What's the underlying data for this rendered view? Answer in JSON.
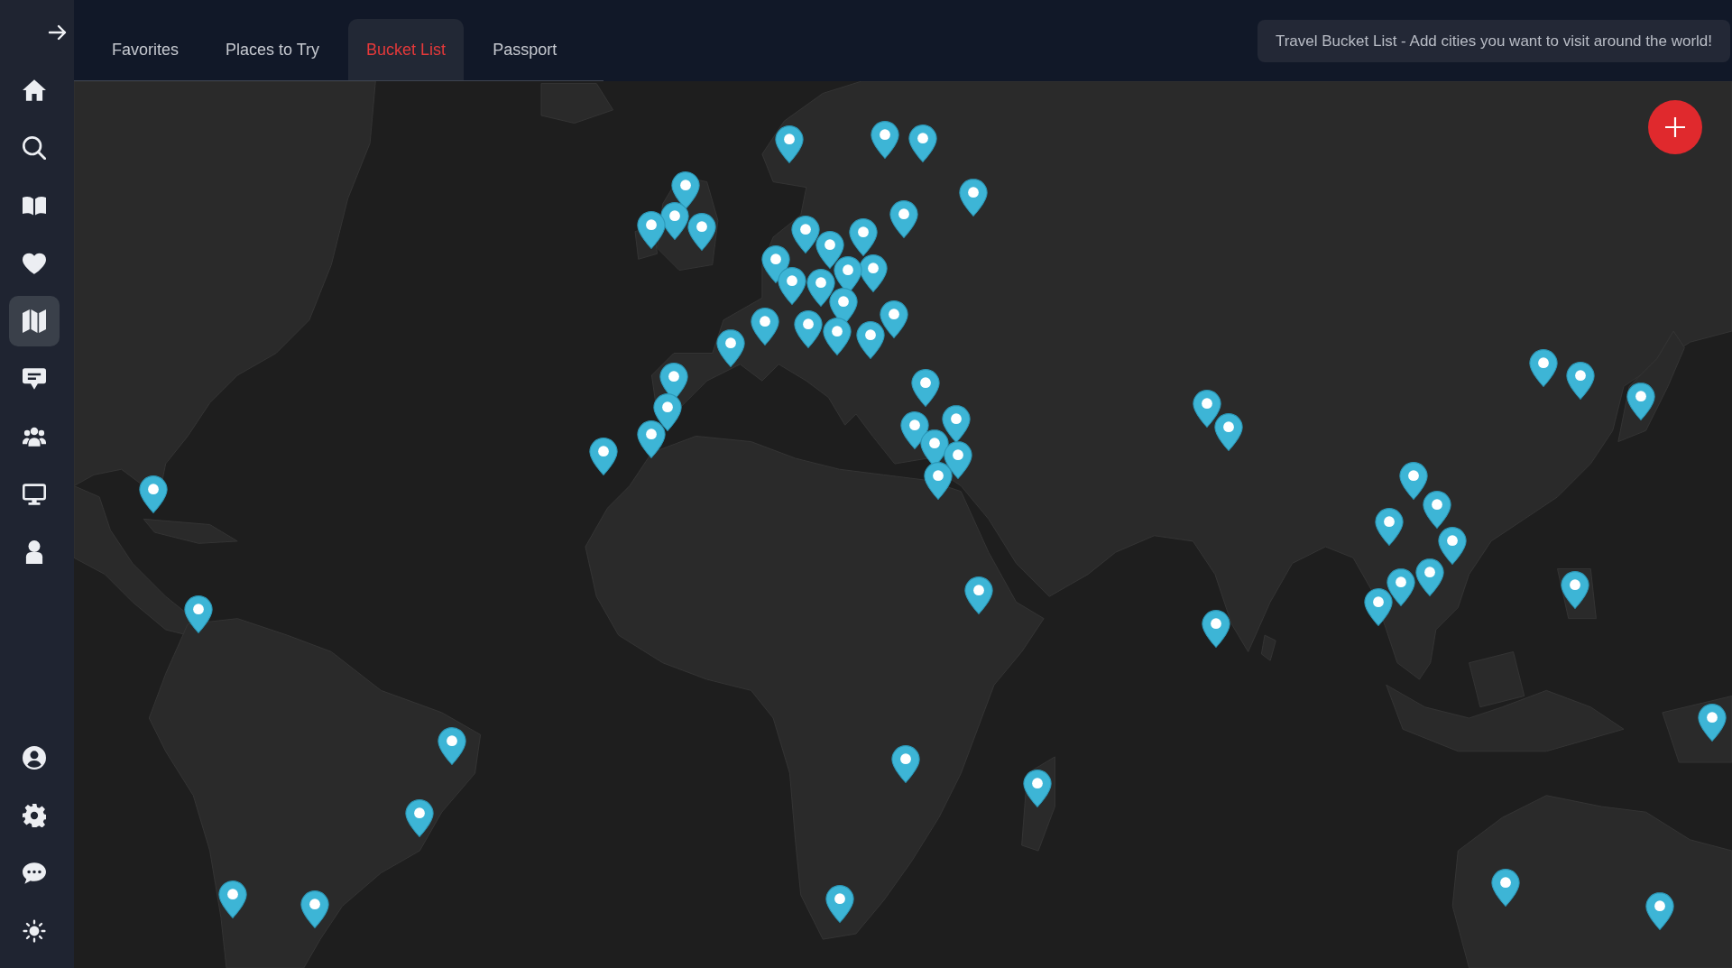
{
  "sidebar": {
    "nav_items": [
      {
        "selected": false
      },
      {
        "selected": false
      },
      {
        "selected": false
      },
      {
        "selected": false
      },
      {
        "selected": true
      },
      {
        "selected": false
      },
      {
        "selected": false
      },
      {
        "selected": false
      },
      {
        "selected": false
      }
    ]
  },
  "tabs": [
    {
      "label": "Favorites",
      "selected": false
    },
    {
      "label": "Places to Try",
      "selected": false
    },
    {
      "label": "Bucket List",
      "selected": true
    },
    {
      "label": "Passport",
      "selected": false
    }
  ],
  "info_banner": {
    "text": "Travel Bucket List - Add cities you want to visit around the world!"
  }
}
